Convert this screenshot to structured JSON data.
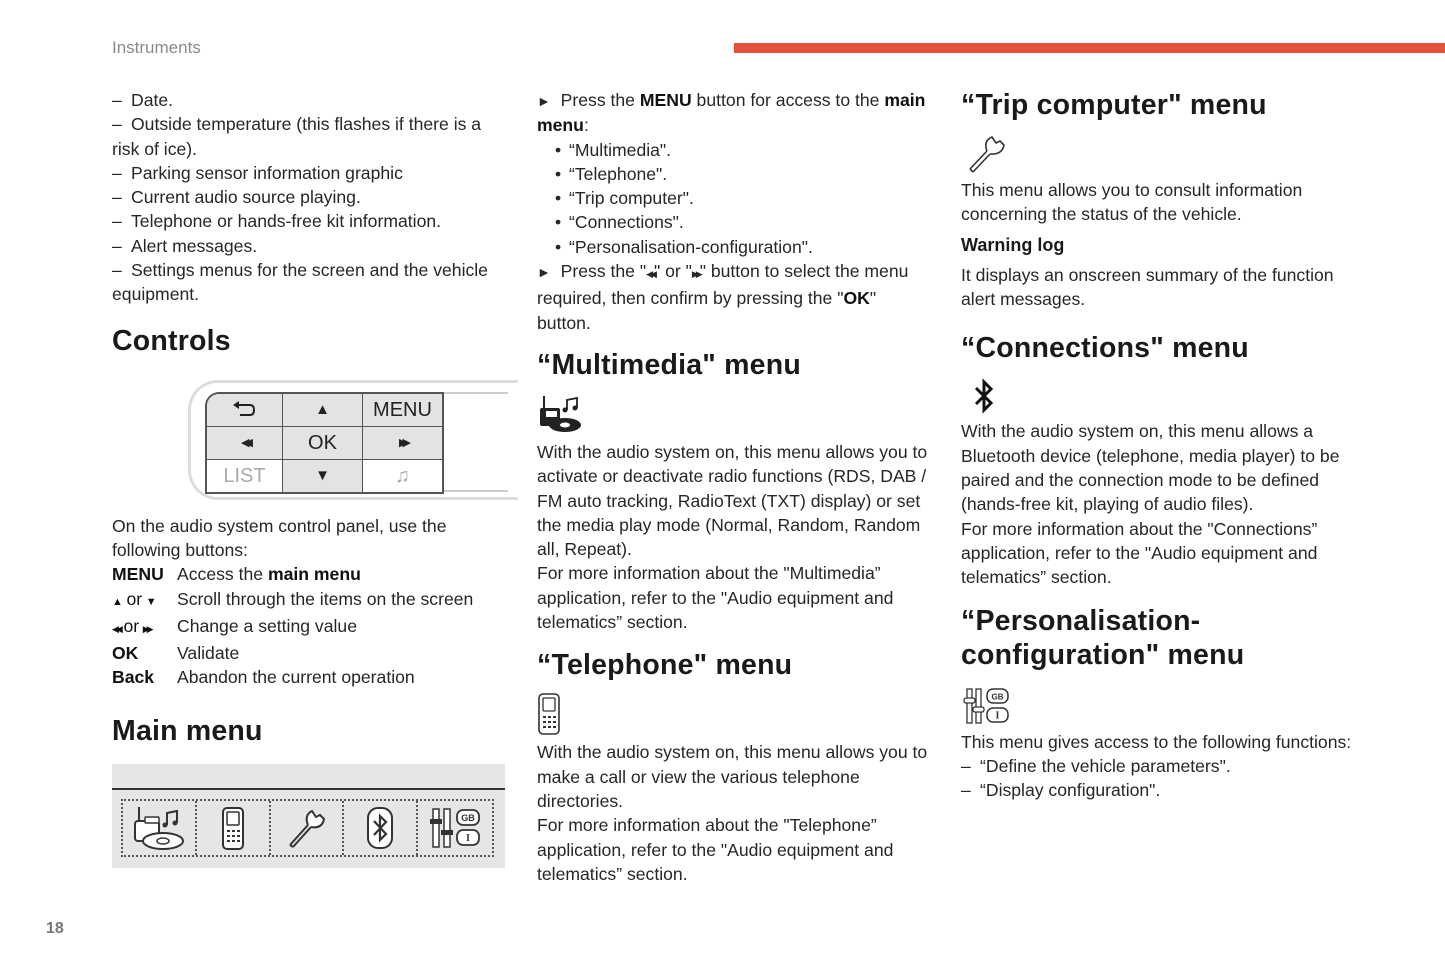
{
  "header": {
    "section": "Instruments",
    "accent_color": "#e2503c"
  },
  "page_number": "18",
  "col1": {
    "intro_items": [
      "Date.",
      "Outside temperature (this flashes if there is a risk of ice).",
      "Parking sensor information graphic",
      "Current audio source playing.",
      "Telephone or hands-free kit information.",
      "Alert messages.",
      "Settings menus for the screen and the vehicle equipment."
    ],
    "controls_title": "Controls",
    "panel": {
      "back_icon": "back-arrow",
      "up_icon": "▲",
      "menu": "MENU",
      "prev_icon": "◀◀",
      "ok": "OK",
      "next_icon": "▶▶",
      "list": "LIST",
      "down_icon": "▼",
      "music_icon": "♫"
    },
    "controls_intro": "On the audio system control panel, use the following buttons:",
    "controls": [
      {
        "key": "MENU",
        "desc_pre": "Access the ",
        "desc_bold": "main menu"
      },
      {
        "key_a": "▲",
        "key_or": "or",
        "key_b": "▼",
        "desc": "Scroll through the items on the screen"
      },
      {
        "key_a": "◀◀",
        "key_or": "or",
        "key_b": "▶▶",
        "desc": "Change a setting value"
      },
      {
        "key": "OK",
        "desc": "Validate"
      },
      {
        "key": "Back",
        "desc": "Abandon the current operation"
      }
    ],
    "main_menu_title": "Main menu",
    "main_menu_icons": [
      "multimedia-icon",
      "telephone-icon",
      "trip-computer-icon",
      "bluetooth-icon",
      "personalisation-icon"
    ]
  },
  "col2": {
    "step1_pre": "Press the ",
    "step1_bold1": "MENU",
    "step1_mid": " button for access to the ",
    "step1_bold2": "main menu",
    "step1_post": ":",
    "menu_items": [
      "“Multimedia\".",
      "“Telephone\".",
      "“Trip computer\".",
      "“Connections\".",
      "“Personalisation-configuration\"."
    ],
    "step2_pre": "Press the \"",
    "step2_prev": "◀◀",
    "step2_or": "\" or \"",
    "step2_next": "▶▶",
    "step2_mid": "\" button to select the menu required, then confirm by pressing the \"",
    "step2_bold": "OK",
    "step2_post": "\" button.",
    "multimedia": {
      "title": "“Multimedia\" menu",
      "text": "With the audio system on, this menu allows you to activate or deactivate radio functions (RDS, DAB / FM auto tracking, RadioText (TXT) display) or set the media play mode (Normal, Random, Random all, Repeat).",
      "more": "For more information about the \"Multimedia” application, refer to the \"Audio equipment and telematics” section."
    },
    "telephone": {
      "title": "“Telephone\" menu",
      "text": "With the audio system on, this menu allows you to make a call or view the various telephone directories.",
      "more": "For more information about the \"Telephone” application, refer to the \"Audio equipment and telematics” section."
    }
  },
  "col3": {
    "trip": {
      "title": "“Trip computer\" menu",
      "text": "This menu allows you to consult information concerning the status of the vehicle.",
      "subtitle": "Warning log",
      "subtext": "It displays an onscreen summary of the function alert messages."
    },
    "connections": {
      "title": "“Connections\" menu",
      "text": "With the audio system on, this menu allows a Bluetooth device (telephone, media player) to be paired and the connection mode to be defined (hands-free kit, playing of audio files).",
      "more": "For more information about the \"Connections” application, refer to the \"Audio equipment and telematics” section."
    },
    "personalisation": {
      "title_line1": "“Personalisation-",
      "title_line2": "configuration\" menu",
      "text": "This menu gives access to the following functions:",
      "items": [
        "“Define the vehicle parameters\".",
        "“Display configuration\"."
      ]
    }
  }
}
